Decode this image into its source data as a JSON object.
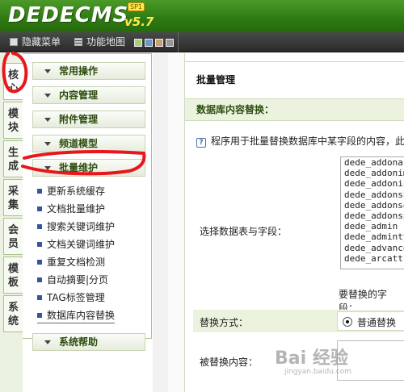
{
  "header": {
    "logo": "DEDECMS",
    "version": "v5.7",
    "sp": "SP1"
  },
  "toolbar": {
    "hide_menu": "隐藏菜单",
    "site_map": "功能地图",
    "skins": [
      "#a8d070",
      "#6a9acb",
      "#c8a070",
      "#999999"
    ]
  },
  "left_tabs": [
    "核心",
    "模块",
    "生成",
    "采集",
    "会员",
    "模板",
    "系统"
  ],
  "menu": {
    "categories": [
      "常用操作",
      "内容管理",
      "附件管理",
      "频道模型",
      "批量维护",
      "系统帮助"
    ],
    "items": [
      "更新系统缓存",
      "文档批量维护",
      "搜索关键词维护",
      "文档关键词维护",
      "重复文档检测",
      "自动摘要|分页",
      "TAG标签管理",
      "数据库内容替换"
    ]
  },
  "main": {
    "title": "批量管理",
    "section": "数据库内容替换：",
    "help": "程序用于批量替换数据库中某字段的内容，此",
    "select_label": "选择数据表与字段：",
    "tables": [
      "dede_addonarticle",
      "dede_addonimages",
      "dede_addoninfos",
      "dede_addonshop",
      "dede_addonsoft",
      "dede_addonspec",
      "dede_admin",
      "dede_admintype",
      "dede_advancedsearch",
      "dede_arcatt"
    ],
    "field_label": "要替换的字段：",
    "mode_label": "替换方式：",
    "mode_value": "普通替换",
    "replace_from": "被替换内容："
  },
  "watermark": {
    "main": "Bai 经验",
    "sub": "jingyan.baidu.com"
  }
}
